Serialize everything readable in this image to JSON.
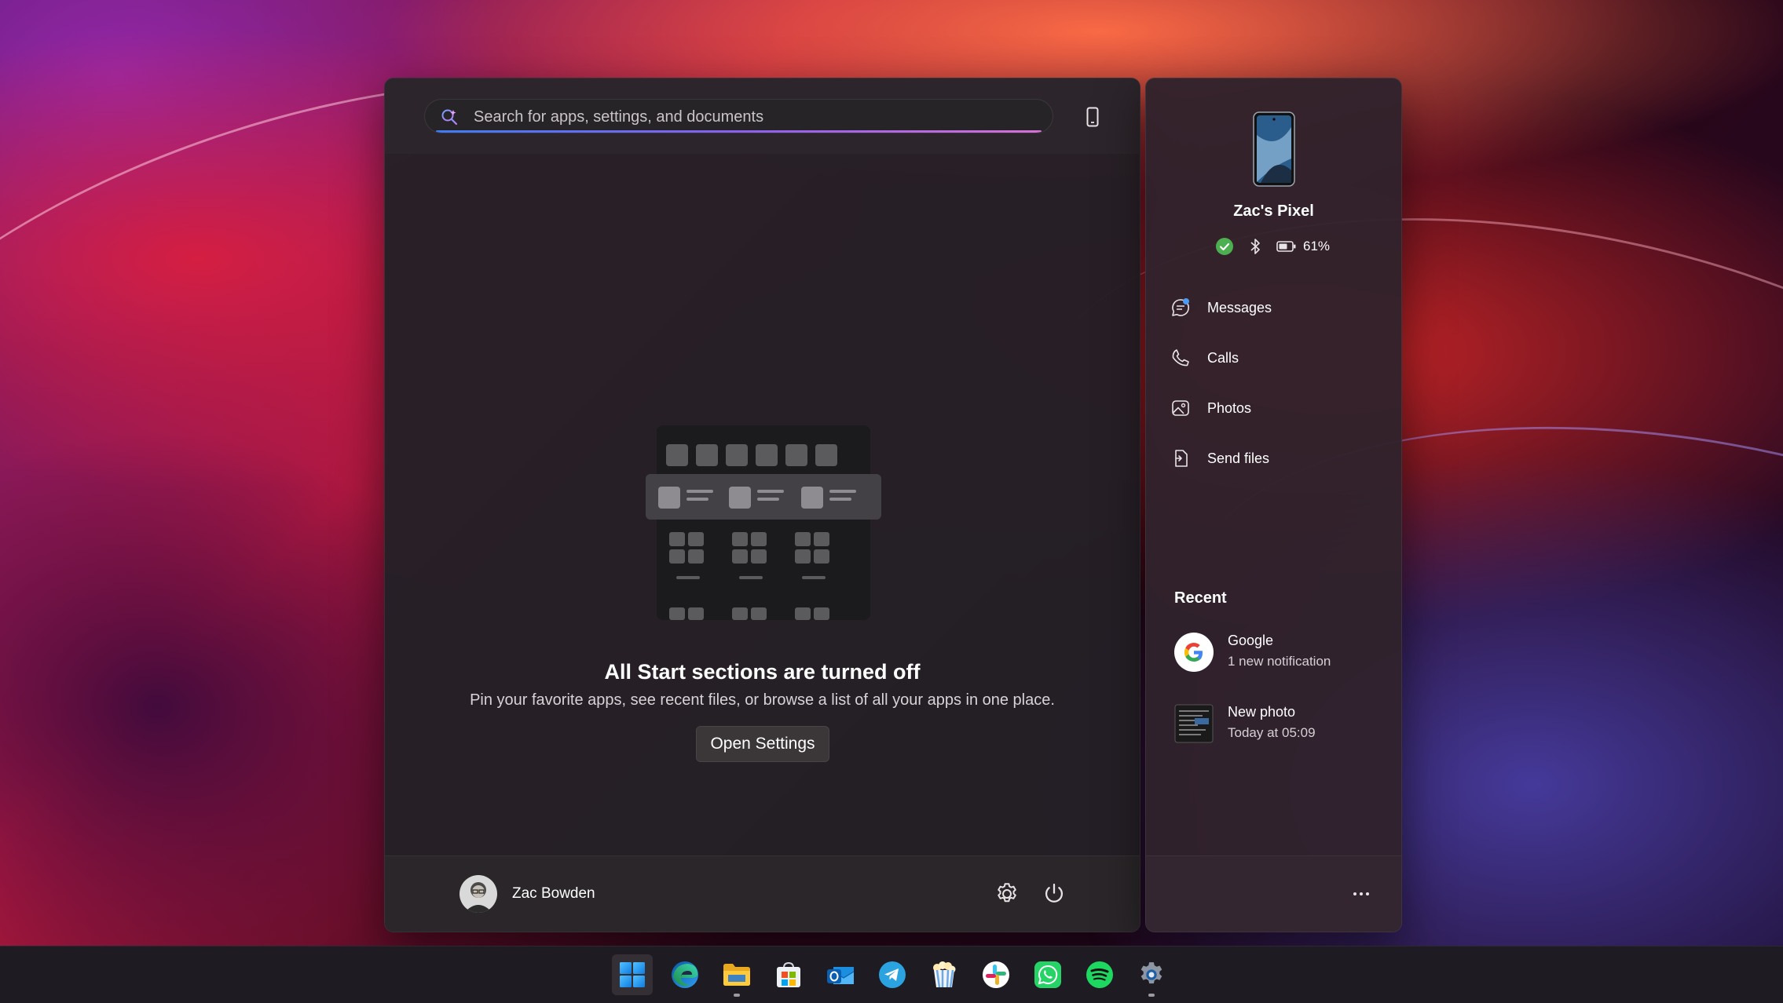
{
  "search": {
    "placeholder": "Search for apps, settings, and documents"
  },
  "start": {
    "empty_title": "All Start sections are turned off",
    "empty_description": "Pin your favorite apps, see recent files, or browse a list of all your apps in one place.",
    "open_settings_label": "Open Settings",
    "user_name": "Zac Bowden",
    "footer_icons": [
      "gear-icon",
      "power-icon"
    ]
  },
  "phone": {
    "device_name": "Zac's Pixel",
    "battery": "61%",
    "status_icons": [
      "connected-check-icon",
      "bluetooth-icon",
      "battery-icon"
    ],
    "menu": [
      {
        "label": "Messages",
        "icon": "message-icon"
      },
      {
        "label": "Calls",
        "icon": "phone-call-icon"
      },
      {
        "label": "Photos",
        "icon": "photo-icon"
      },
      {
        "label": "Send files",
        "icon": "send-file-icon"
      }
    ],
    "recent_heading": "Recent",
    "recent": [
      {
        "title": "Google",
        "subtitle": "1 new notification",
        "icon": "google-icon"
      },
      {
        "title": "New photo",
        "subtitle": "Today at 05:09",
        "icon": "photo-thumbnail"
      }
    ]
  },
  "taskbar": {
    "apps": [
      {
        "name": "start",
        "icon": "windows-logo-icon",
        "active": true
      },
      {
        "name": "edge",
        "icon": "edge-icon"
      },
      {
        "name": "file-explorer",
        "icon": "folder-icon",
        "running": true
      },
      {
        "name": "store",
        "icon": "store-icon"
      },
      {
        "name": "outlook",
        "icon": "outlook-icon"
      },
      {
        "name": "telegram",
        "icon": "telegram-icon"
      },
      {
        "name": "popcorn",
        "icon": "popcorn-icon"
      },
      {
        "name": "slack",
        "icon": "slack-icon"
      },
      {
        "name": "whatsapp",
        "icon": "whatsapp-icon"
      },
      {
        "name": "spotify",
        "icon": "spotify-icon"
      },
      {
        "name": "settings",
        "icon": "settings-gear-icon",
        "running": true
      }
    ]
  },
  "colors": {
    "accent": "#4c9bf0",
    "connected": "#4caf50",
    "panel_bg": "#242026",
    "phone_panel_bg": "#30222c"
  }
}
